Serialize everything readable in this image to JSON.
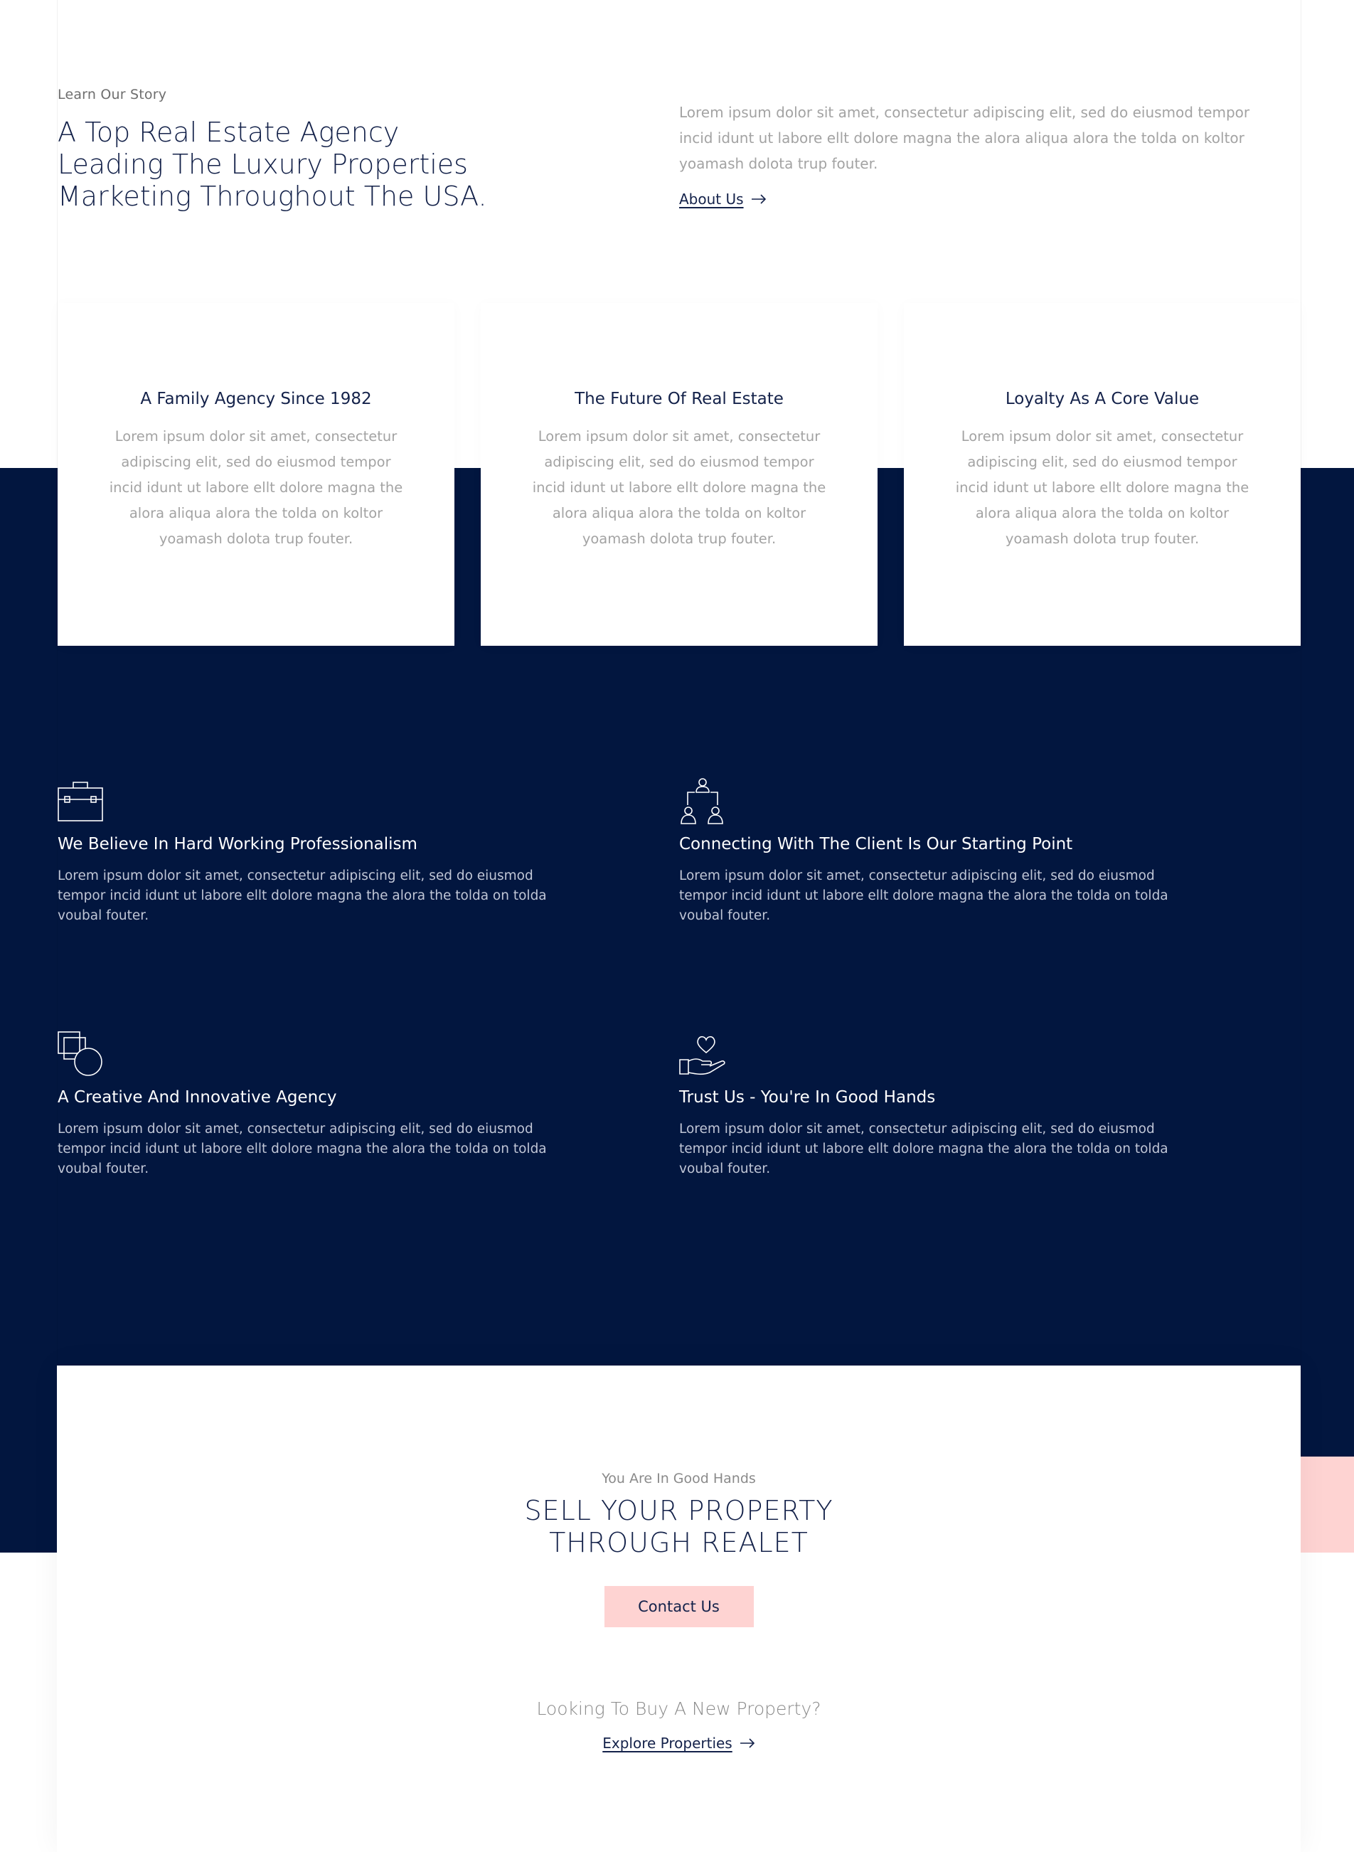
{
  "intro": {
    "kicker": "Learn Our Story",
    "title_lines": [
      "A Top Real Estate Agency",
      "Leading The Luxury Properties",
      "Marketing Throughout The USA."
    ],
    "description": "Lorem ipsum dolor sit amet, consectetur adipiscing elit, sed do eiusmod tempor incid idunt ut labore ellt dolore magna the alora aliqua alora the tolda on koltor yoamash dolota trup fouter.",
    "link_label": "About Us",
    "link_icon": "arrow-right-icon"
  },
  "cards": [
    {
      "title": "A Family Agency Since 1982",
      "text": "Lorem ipsum dolor sit amet, consectetur adipiscing elit, sed do eiusmod tempor incid idunt ut labore ellt dolore magna the alora aliqua alora the tolda on koltor yoamash dolota trup fouter."
    },
    {
      "title": "The Future Of Real Estate",
      "text": "Lorem ipsum dolor sit amet, consectetur adipiscing elit, sed do eiusmod tempor incid idunt ut labore ellt dolore magna the alora aliqua alora the tolda on koltor yoamash dolota trup fouter."
    },
    {
      "title": "Loyalty As A Core Value",
      "text": "Lorem ipsum dolor sit amet, consectetur adipiscing elit, sed do eiusmod tempor incid idunt ut labore ellt dolore magna the alora aliqua alora the tolda on koltor yoamash dolota trup fouter."
    }
  ],
  "features": [
    {
      "icon": "briefcase-icon",
      "title": "We Believe In Hard Working Professionalism",
      "text": "Lorem ipsum dolor sit amet, consectetur adipiscing elit, sed do eiusmod tempor incid idunt ut labore ellt dolore magna the alora the tolda on tolda voubal fouter."
    },
    {
      "icon": "team-network-icon",
      "title": "Connecting With The Client Is Our Starting Point",
      "text": "Lorem ipsum dolor sit amet, consectetur adipiscing elit, sed do eiusmod tempor incid idunt ut labore ellt dolore magna the alora the tolda on tolda voubal fouter."
    },
    {
      "icon": "shapes-icon",
      "title": "A Creative And Innovative Agency",
      "text": "Lorem ipsum dolor sit amet, consectetur adipiscing elit, sed do eiusmod tempor incid idunt ut labore ellt dolore magna the alora the tolda on tolda voubal fouter."
    },
    {
      "icon": "hand-heart-icon",
      "title": "Trust Us - You're In Good Hands",
      "text": "Lorem ipsum dolor sit amet, consectetur adipiscing elit, sed do eiusmod tempor incid idunt ut labore ellt dolore magna the alora the tolda on tolda voubal fouter."
    }
  ],
  "sell": {
    "kicker": "You Are In Good Hands",
    "title_lines": [
      "SELL YOUR PROPERTY",
      "THROUGH REALET"
    ],
    "button_label": "Contact Us",
    "question": "Looking To Buy A New Property?",
    "link_label": "Explore Properties",
    "link_icon": "arrow-right-icon"
  },
  "colors": {
    "navy": "#02163f",
    "pink": "#fed3d2",
    "heading": "#14224a",
    "muted": "#a3a3a3"
  }
}
